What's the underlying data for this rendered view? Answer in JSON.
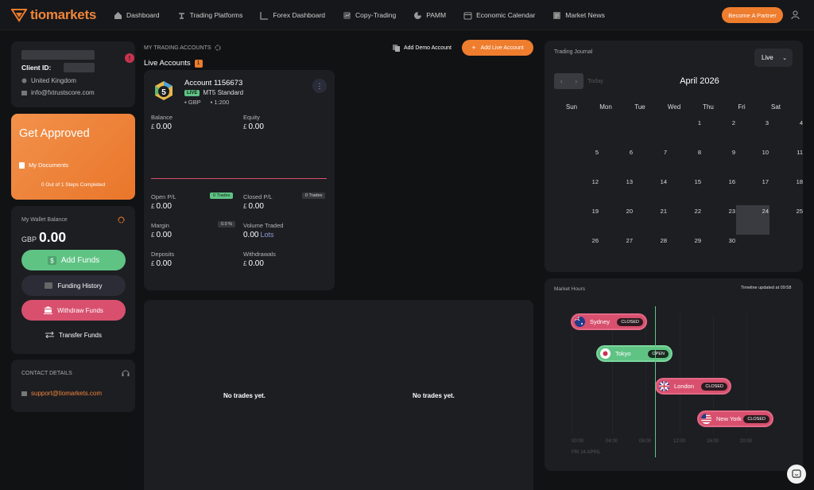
{
  "brand": {
    "name": "tiomarkets",
    "accent": "#ee7d2e"
  },
  "nav": [
    {
      "label": "Dashboard",
      "icon": "home-icon"
    },
    {
      "label": "Trading Platforms",
      "icon": "platform-icon"
    },
    {
      "label": "Forex Dashboard",
      "icon": "chart-icon"
    },
    {
      "label": "Copy-Trading",
      "icon": "copy-icon"
    },
    {
      "label": "PAMM",
      "icon": "pie-icon"
    },
    {
      "label": "Economic Calendar",
      "icon": "calendar-icon"
    },
    {
      "label": "Market News",
      "icon": "news-icon"
    }
  ],
  "partner_label": "Become A Partner",
  "client": {
    "id_label": "Client ID:",
    "country": "United Kingdom",
    "email": "info@fxtrustscore.com",
    "alert": "!"
  },
  "approved": {
    "title": "Get Approved",
    "docs_label": "My Documents",
    "steps": "0 Out of 1 Steps Completed"
  },
  "wallet": {
    "title": "My Wallet Balance",
    "currency": "GBP",
    "amount": "0.00",
    "add": "Add Funds",
    "history": "Funding History",
    "withdraw": "Withdraw Funds",
    "transfer": "Transfer Funds"
  },
  "contact": {
    "title": "CONTACT DETAILS",
    "email": "support@tiomarkets.com"
  },
  "accounts": {
    "section_label": "MY TRADING ACCOUNTS",
    "live_label": "Live Accounts",
    "live_count": "1",
    "demo_btn": "Add Demo Account",
    "live_btn": "Add Live Account",
    "card": {
      "name": "Account 1156673",
      "badge": "LIVE",
      "type": "MT5 Standard",
      "currency": "GBP",
      "leverage": "1:200",
      "menu": "⋮",
      "balance_label": "Balance",
      "balance": "0.00",
      "equity_label": "Equity",
      "equity": "0.00",
      "open_pl_label": "Open P/L",
      "open_pl": "0.00",
      "open_trades": "0 Trades",
      "closed_pl_label": "Closed P/L",
      "closed_pl": "0.00",
      "closed_trades": "0 Trades",
      "margin_label": "Margin",
      "margin": "0.00",
      "margin_pct": "0.0 %",
      "volume_label": "Volume Traded",
      "volume": "0.00",
      "volume_unit": "Lots",
      "deposits_label": "Deposits",
      "deposits": "0.00",
      "withdrawals_label": "Withdrawals",
      "withdrawals": "0.00",
      "currency_symbol": "£"
    }
  },
  "trades": {
    "empty_left": "No trades yet.",
    "empty_right": "No trades yet."
  },
  "journal": {
    "title": "Trading Journal",
    "select": "Live",
    "today": "Today",
    "month": "April 2026",
    "dow": [
      "Sun",
      "Mon",
      "Tue",
      "Wed",
      "Thu",
      "Fri",
      "Sat"
    ],
    "weeks": [
      [
        "",
        "",
        "",
        "1",
        "2",
        "3",
        "4"
      ],
      [
        "5",
        "6",
        "7",
        "8",
        "9",
        "10",
        "11"
      ],
      [
        "12",
        "13",
        "14",
        "15",
        "16",
        "17",
        "18"
      ],
      [
        "19",
        "20",
        "21",
        "22",
        "23",
        "24",
        "25"
      ],
      [
        "26",
        "27",
        "28",
        "29",
        "30",
        "",
        ""
      ]
    ],
    "highlight_day": "24"
  },
  "market": {
    "title": "Market Hours",
    "updated": "Timeline updated at 09:58",
    "sessions": [
      {
        "name": "Sydney",
        "status": "CLOSED"
      },
      {
        "name": "Tokyo",
        "status": "OPEN"
      },
      {
        "name": "London",
        "status": "CLOSED"
      },
      {
        "name": "New York",
        "status": "CLOSED"
      }
    ],
    "ticks": [
      "00:00",
      "04:00",
      "08:00",
      "12:00",
      "16:00",
      "20:00"
    ],
    "date": "FRI 24 APRIL"
  }
}
